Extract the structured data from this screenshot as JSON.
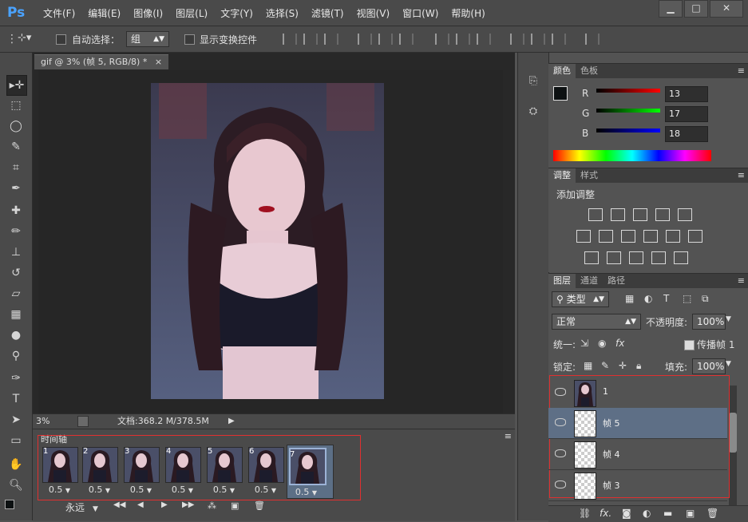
{
  "menubar": {
    "logo": "Ps",
    "items": [
      "文件(F)",
      "编辑(E)",
      "图像(I)",
      "图层(L)",
      "文字(Y)",
      "选择(S)",
      "滤镜(T)",
      "视图(V)",
      "窗口(W)",
      "帮助(H)"
    ],
    "window_buttons": [
      "▁",
      "□",
      "✕"
    ]
  },
  "options": {
    "auto_select_label": "自动选择：",
    "auto_select_value": "组",
    "show_transform_label": "显示变换控件"
  },
  "document": {
    "tab_title": "gif @ 3% (帧 5, RGB/8) *",
    "tab_close": "×",
    "zoom": "3%",
    "doc_info": "文档:368.2 M/378.5M"
  },
  "timeline": {
    "title": "时间轴",
    "frames": [
      {
        "num": "1",
        "delay": "0.5"
      },
      {
        "num": "2",
        "delay": "0.5"
      },
      {
        "num": "3",
        "delay": "0.5"
      },
      {
        "num": "4",
        "delay": "0.5"
      },
      {
        "num": "5",
        "delay": "0.5"
      },
      {
        "num": "6",
        "delay": "0.5"
      },
      {
        "num": "7",
        "delay": "0.5"
      }
    ],
    "loop_value": "永远"
  },
  "color_panel": {
    "tabs": [
      "颜色",
      "色板"
    ],
    "r_label": "R",
    "g_label": "G",
    "b_label": "B",
    "r": "13",
    "g": "17",
    "b": "18",
    "fg_color": "#0d1112",
    "bg_color": "#1aa0d8"
  },
  "adjust_panel": {
    "tabs": [
      "调整",
      "样式"
    ],
    "title": "添加调整"
  },
  "layers_panel": {
    "tabs": [
      "图层",
      "通道",
      "路径"
    ],
    "filter_value": "类型",
    "blend_mode": "正常",
    "opacity_label": "不透明度:",
    "opacity_value": "100%",
    "unify_label": "统一:",
    "propagate_label": "传播帧 1",
    "lock_label": "锁定:",
    "fill_label": "填充:",
    "fill_value": "100%",
    "layers": [
      {
        "name": "1",
        "has_photo": true
      },
      {
        "name": "帧 5",
        "has_photo": false
      },
      {
        "name": "帧 4",
        "has_photo": false
      },
      {
        "name": "帧 3",
        "has_photo": false
      }
    ]
  },
  "colors": {
    "panel_bg": "#535353",
    "highlight_red": "#e03030",
    "selected_layer": "#5e6f86"
  }
}
